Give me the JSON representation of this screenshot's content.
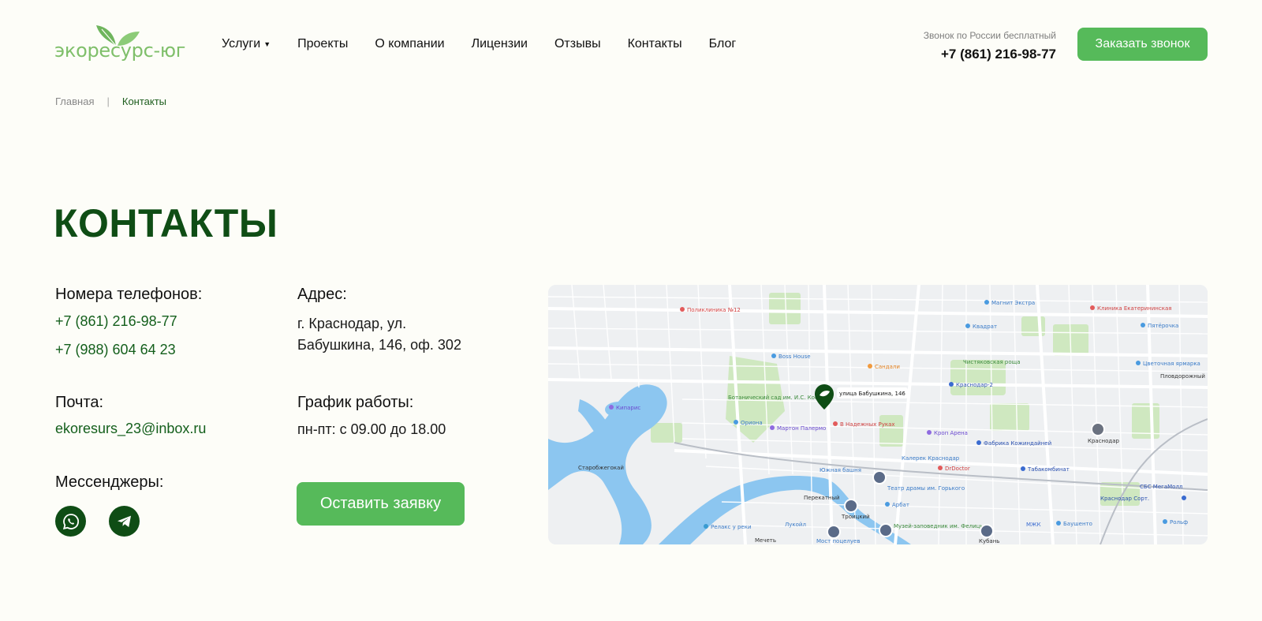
{
  "header": {
    "logo_text": "экоресурс-юг",
    "nav": [
      {
        "label": "Услуги",
        "has_dropdown": true
      },
      {
        "label": "Проекты"
      },
      {
        "label": "О компании"
      },
      {
        "label": "Лицензии"
      },
      {
        "label": "Отзывы"
      },
      {
        "label": "Контакты"
      },
      {
        "label": "Блог"
      }
    ],
    "call_note": "Звонок по России бесплатный",
    "phone": "+7 (861) 216-98-77",
    "call_button": "Заказать звонок"
  },
  "breadcrumb": {
    "home": "Главная",
    "separator": "|",
    "current": "Контакты"
  },
  "page_title": "КОНТАКТЫ",
  "contacts": {
    "phones_label": "Номера телефонов:",
    "phones": [
      "+7 (861) 216-98-77",
      "+7 (988) 604 64 23"
    ],
    "email_label": "Почта:",
    "email": "ekoresurs_23@inbox.ru",
    "messengers_label": "Мессенджеры:",
    "messengers": [
      {
        "icon": "whatsapp-icon"
      },
      {
        "icon": "telegram-icon"
      }
    ],
    "address_label": "Адрес:",
    "address_line1": "г. Краснодар, ул.",
    "address_line2": "Бабушкина, 146, оф. 302",
    "schedule_label": "График работы:",
    "schedule": "пн-пт: с 09.00 до 18.00",
    "request_button": "Оставить заявку"
  },
  "map": {
    "marker_label": "улица Бабушкина, 146",
    "places": [
      "Boss House",
      "Сандали",
      "Кипарис",
      "Старобжегокай",
      "Ботанический сад им. И.С. Косенко",
      "Мартон Палермо",
      "В Надежных Руках",
      "Кроп Арена",
      "Фабрика Кожиндайней",
      "Краснодар",
      "Южная башня",
      "Театр драмы им. Горького",
      "Арбат",
      "Троицкий",
      "Релакс у реки",
      "Лукойл",
      "Мост поцелуев",
      "Музей-заповедник им. Фелицына",
      "Кубань",
      "МЖК",
      "Баушенто",
      "Табакомбинат",
      "DrDoctor",
      "Краснодар Сорт.",
      "СБС МегаМолл",
      "Пятёрочка",
      "Магнит Экстра",
      "Квадрат",
      "Цветочная ярмарка",
      "Пловдорожный",
      "Ориона",
      "Перекатный",
      "Мечеть",
      "Поликлиника №12",
      "Клиника Екатерининская",
      "Краснодар-2",
      "Калерек Краснодар",
      "Чистяковская роща",
      "Рольф"
    ],
    "colors": {
      "water": "#8cc6f0",
      "park": "#c8e6b7",
      "road": "#ffffff",
      "marker": "#0f4d15"
    }
  },
  "colors": {
    "accent_green": "#56ba5a",
    "dark_green": "#0f4d15",
    "logo_green": "#7fbf6a",
    "background": "#fdfdf8"
  }
}
